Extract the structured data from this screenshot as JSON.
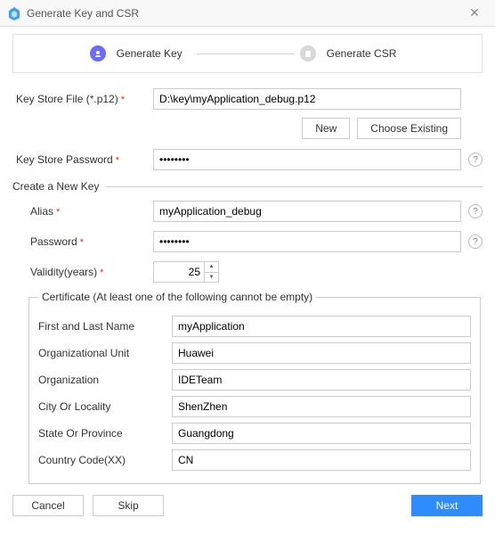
{
  "titlebar": {
    "title": "Generate Key and CSR"
  },
  "stepper": {
    "step1": "Generate Key",
    "step2": "Generate CSR"
  },
  "keystore": {
    "file_label": "Key Store File (*.p12)",
    "file_value": "D:\\key\\myApplication_debug.p12",
    "new_btn": "New",
    "choose_btn": "Choose Existing",
    "password_label": "Key Store Password",
    "password_value": "••••••••"
  },
  "section": {
    "create_key": "Create a New Key"
  },
  "key": {
    "alias_label": "Alias",
    "alias_value": "myApplication_debug",
    "password_label": "Password",
    "password_value": "••••••••",
    "validity_label": "Validity(years)",
    "validity_value": "25"
  },
  "cert": {
    "legend": "Certificate (At least one of the following cannot be empty)",
    "first_last_label": "First and Last Name",
    "first_last_value": "myApplication",
    "org_unit_label": "Organizational Unit",
    "org_unit_value": "Huawei",
    "org_label": "Organization",
    "org_value": "IDETeam",
    "city_label": "City Or Locality",
    "city_value": "ShenZhen",
    "state_label": "State Or Province",
    "state_value": "Guangdong",
    "country_label": "Country Code(XX)",
    "country_value": "CN"
  },
  "footer": {
    "cancel": "Cancel",
    "skip": "Skip",
    "next": "Next"
  }
}
